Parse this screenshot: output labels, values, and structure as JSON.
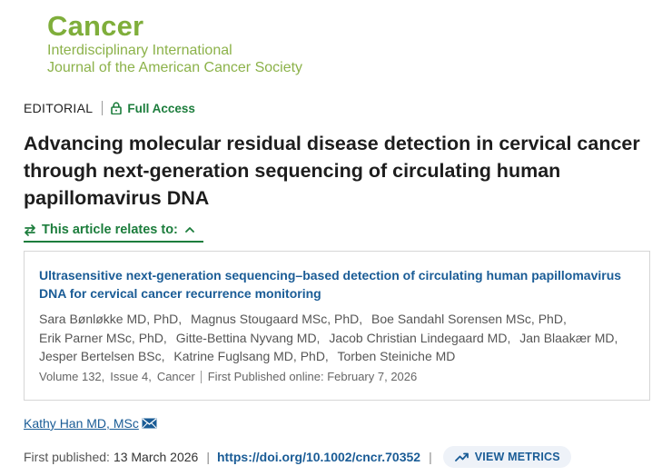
{
  "journal": {
    "name": "Cancer",
    "subtitle_line1": "Interdisciplinary International",
    "subtitle_line2": "Journal of the American Cancer Society",
    "brand_color": "#7fae3b"
  },
  "article": {
    "type": "EDITORIAL",
    "access": "Full Access",
    "title": "Advancing molecular residual disease detection in cervical cancer through next-generation sequencing of circulating human papillomavirus DNA"
  },
  "relates": {
    "label": "This article relates to:",
    "toggle_icon": "chevron-up-icon"
  },
  "related_article": {
    "title": "Ultrasensitive next-generation sequencing–based detection of circulating human papillomavirus DNA for cervical cancer recurrence monitoring",
    "authors": [
      "Sara Bønløkke MD, PhD,",
      "Magnus Stougaard MSc, PhD,",
      "Boe Sandahl Sorensen MSc, PhD,",
      "Erik Parner MSc, PhD,",
      "Gitte-Bettina Nyvang MD,",
      "Jacob Christian Lindegaard MD,",
      "Jan Blaakær MD,",
      "Jesper Bertelsen BSc,",
      "Katrine Fuglsang MD, PhD,",
      "Torben Steiniche MD"
    ],
    "volume": "Volume 132,",
    "issue": "Issue 4,",
    "journal": "Cancer",
    "published": "First Published online: February 7, 2026"
  },
  "author": {
    "name": "Kathy Han MD, MSc",
    "contact_icon": "mail-icon"
  },
  "publication": {
    "first_published_label": "First published:",
    "first_published_date": "13 March 2026",
    "separator": "|",
    "doi": "https://doi.org/10.1002/cncr.70352",
    "metrics_label": "VIEW METRICS"
  },
  "colors": {
    "accent_green": "#1c7d3c",
    "link_blue": "#1a5c96"
  }
}
